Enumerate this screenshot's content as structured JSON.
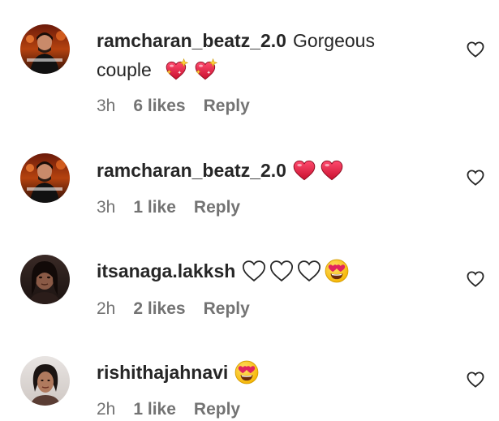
{
  "comments": [
    {
      "username": "ramcharan_beatz_2.0",
      "text_line1": "Gorgeous",
      "text_line2": "couple",
      "emojis": [
        "sparkling-heart",
        "sparkling-heart"
      ],
      "time": "3h",
      "likes": "6 likes",
      "reply": "Reply",
      "avatar": "profile-photo-man-dark-red"
    },
    {
      "username": "ramcharan_beatz_2.0",
      "text": "",
      "emojis": [
        "red-heart",
        "red-heart"
      ],
      "time": "3h",
      "likes": "1 like",
      "reply": "Reply",
      "avatar": "profile-photo-man-dark-red"
    },
    {
      "username": "itsanaga.lakksh",
      "text": "",
      "emojis": [
        "white-heart",
        "white-heart",
        "white-heart",
        "heart-eyes-face"
      ],
      "time": "2h",
      "likes": "2 likes",
      "reply": "Reply",
      "avatar": "profile-photo-woman"
    },
    {
      "username": "rishithajahnavi",
      "text": "",
      "emojis": [
        "heart-eyes-face"
      ],
      "time": "2h",
      "likes": "1 like",
      "reply": "Reply",
      "avatar": "profile-photo-woman-light"
    }
  ],
  "colors": {
    "text": "#262626",
    "secondary": "#737373",
    "heart_red": "#e0245e",
    "emoji_yellow": "#ffcc33"
  }
}
